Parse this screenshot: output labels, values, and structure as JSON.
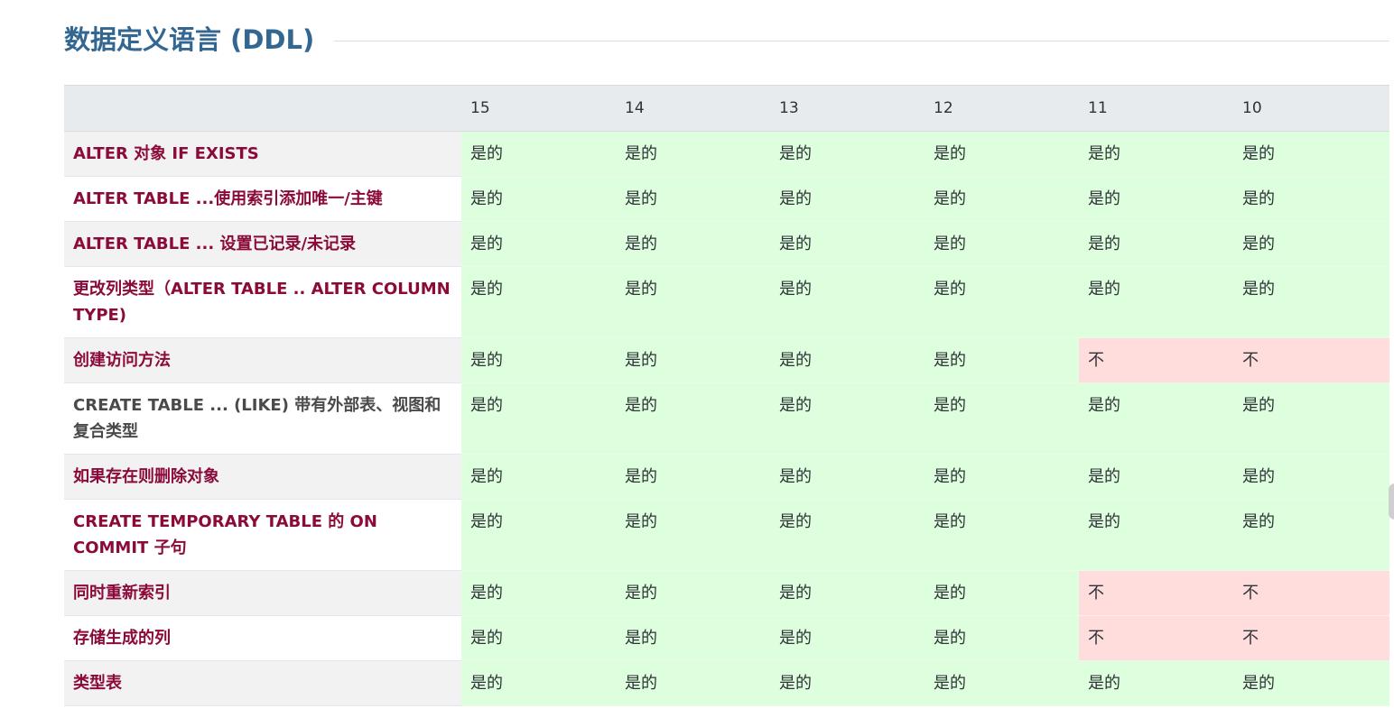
{
  "section": {
    "title": "数据定义语言 (DDL)"
  },
  "table": {
    "versions": [
      "15",
      "14",
      "13",
      "12",
      "11",
      "10"
    ],
    "rows": [
      {
        "feature": "ALTER 对象 IF EXISTS",
        "values": [
          "是的",
          "是的",
          "是的",
          "是的",
          "是的",
          "是的"
        ]
      },
      {
        "feature": "ALTER TABLE ...使用索引添加唯一/主键",
        "values": [
          "是的",
          "是的",
          "是的",
          "是的",
          "是的",
          "是的"
        ]
      },
      {
        "feature": "ALTER TABLE ... 设置已记录/未记录",
        "values": [
          "是的",
          "是的",
          "是的",
          "是的",
          "是的",
          "是的"
        ]
      },
      {
        "feature": "更改列类型（ALTER TABLE .. ALTER COLUMN TYPE)",
        "values": [
          "是的",
          "是的",
          "是的",
          "是的",
          "是的",
          "是的"
        ]
      },
      {
        "feature": "创建访问方法",
        "values": [
          "是的",
          "是的",
          "是的",
          "是的",
          "不",
          "不"
        ]
      },
      {
        "feature": "CREATE TABLE ... (LIKE) 带有外部表、视图和复合类型",
        "values": [
          "是的",
          "是的",
          "是的",
          "是的",
          "是的",
          "是的"
        ]
      },
      {
        "feature": "如果存在则删除对象",
        "values": [
          "是的",
          "是的",
          "是的",
          "是的",
          "是的",
          "是的"
        ]
      },
      {
        "feature": "CREATE TEMPORARY TABLE 的 ON COMMIT 子句",
        "values": [
          "是的",
          "是的",
          "是的",
          "是的",
          "是的",
          "是的"
        ]
      },
      {
        "feature": "同时重新索引",
        "values": [
          "是的",
          "是的",
          "是的",
          "是的",
          "不",
          "不"
        ]
      },
      {
        "feature": "存储生成的列",
        "values": [
          "是的",
          "是的",
          "是的",
          "是的",
          "不",
          "不"
        ]
      },
      {
        "feature": "类型表",
        "values": [
          "是的",
          "是的",
          "是的",
          "是的",
          "是的",
          "是的"
        ]
      }
    ]
  },
  "colors": {
    "heading": "#336791",
    "feature_link": "#8b0a3a",
    "supported_bg": "#ddffdd",
    "unsupported_bg": "#ffdddd",
    "header_bg": "#e8ebee"
  }
}
